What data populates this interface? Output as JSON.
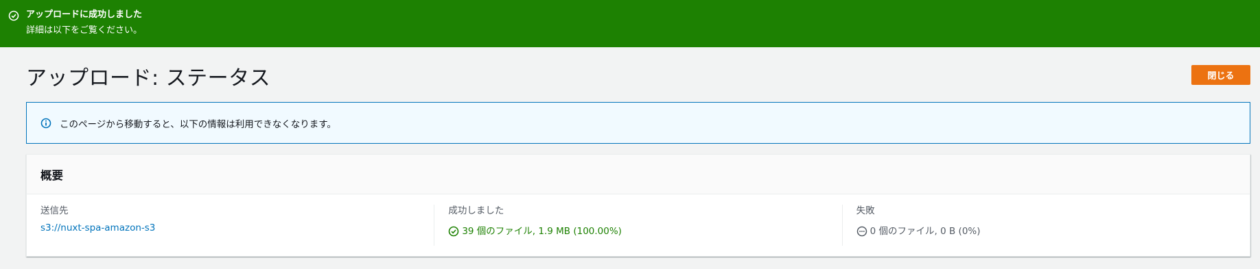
{
  "flash": {
    "title": "アップロードに成功しました",
    "subtitle": "詳細は以下をご覧ください。",
    "icon": "check-circle-icon",
    "color": "#1d8102"
  },
  "header": {
    "title": "アップロード: ステータス",
    "close_label": "閉じる",
    "accent": "#ec7211"
  },
  "info": {
    "icon": "info-icon",
    "text": "このページから移動すると、以下の情報は利用できなくなります。"
  },
  "summary": {
    "title": "概要",
    "destination": {
      "label": "送信先",
      "value": "s3://nuxt-spa-amazon-s3"
    },
    "succeeded": {
      "label": "成功しました",
      "value": "39 個のファイル, 1.9 MB (100.00%)",
      "icon": "check-circle-icon"
    },
    "failed": {
      "label": "失敗",
      "value": "0 個のファイル, 0 B (0%)",
      "icon": "ellipsis-circle-icon"
    }
  }
}
